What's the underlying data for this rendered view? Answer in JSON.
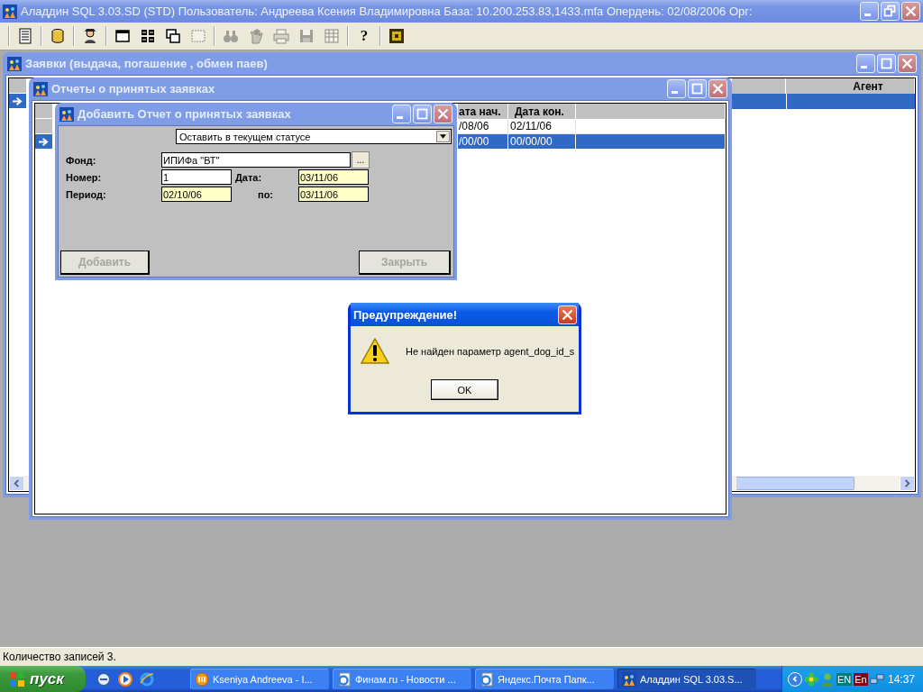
{
  "app_window": {
    "title": "Аладдин SQL 3.03.SD (STD)  Пользователь: Андреева Ксения Владимировна База: 10.200.253.83,1433.mfa Опердень: 02/08/2006 Орг:"
  },
  "toolbar_groups": [
    [
      {
        "disabled": false
      }
    ],
    [
      {
        "disabled": false
      }
    ],
    [
      {
        "disabled": false
      }
    ],
    [
      {
        "disabled": false
      },
      {
        "disabled": false
      },
      {
        "disabled": false
      },
      {
        "disabled": true
      }
    ],
    [
      {
        "disabled": true
      },
      {
        "disabled": true
      },
      {
        "disabled": true
      },
      {
        "disabled": true
      },
      {
        "disabled": true
      }
    ],
    [
      {
        "disabled": false,
        "glyph": "?"
      }
    ],
    [
      {
        "disabled": false
      }
    ]
  ],
  "requests_window": {
    "title": "Заявки (выдача, погашение , обмен паев)",
    "table": {
      "columns": [
        "Агент"
      ],
      "rows": [
        {
          "selected": true
        }
      ]
    }
  },
  "reports_window": {
    "title": "Отчеты о принятых заявках",
    "table": {
      "columns": [
        "ата нач.",
        "Дата кон."
      ],
      "rows": [
        {
          "cells": [
            "/08/06",
            "02/11/06"
          ],
          "selected": false
        },
        {
          "cells": [
            "/00/00",
            "00/00/00"
          ],
          "selected": true
        }
      ]
    }
  },
  "add_dialog": {
    "title": "Добавить Отчет о принятых заявках",
    "status_select": {
      "value": "Оставить в текущем статусе"
    },
    "fund": {
      "label": "Фонд:",
      "value": "ИПИФа \"ВТ\"",
      "browse": "..."
    },
    "number": {
      "label": "Номер:",
      "value": "1",
      "highlighted": false
    },
    "date": {
      "label": "Дата:",
      "value": "03/11/06",
      "highlighted": true
    },
    "period_from": {
      "label": "Период:",
      "value": "02/10/06",
      "highlighted": true
    },
    "period_to": {
      "label": "по:",
      "value": "03/11/06",
      "highlighted": true
    },
    "buttons": [
      {
        "label": "Добавить",
        "disabled": true
      },
      {
        "label": "Закрыть",
        "disabled": true
      }
    ]
  },
  "warning_dialog": {
    "title": "Предупреждение!",
    "message": "Не найден параметр agent_dog_id_s",
    "button": "OK"
  },
  "status_bar": "Количество записей 3.",
  "taskbar": {
    "start": "пуск",
    "tasks": [
      {
        "label": "Kseniya Andreeva - I...",
        "selected": false
      },
      {
        "label": "Финам.ru - Новости ...",
        "selected": false
      },
      {
        "label": "Яндекс.Почта Папк...",
        "selected": false
      },
      {
        "label": "Аладдин SQL 3.03.S...",
        "selected": true
      }
    ],
    "tray": {
      "language": "EN",
      "layout": "En",
      "clock": "14:37"
    }
  }
}
